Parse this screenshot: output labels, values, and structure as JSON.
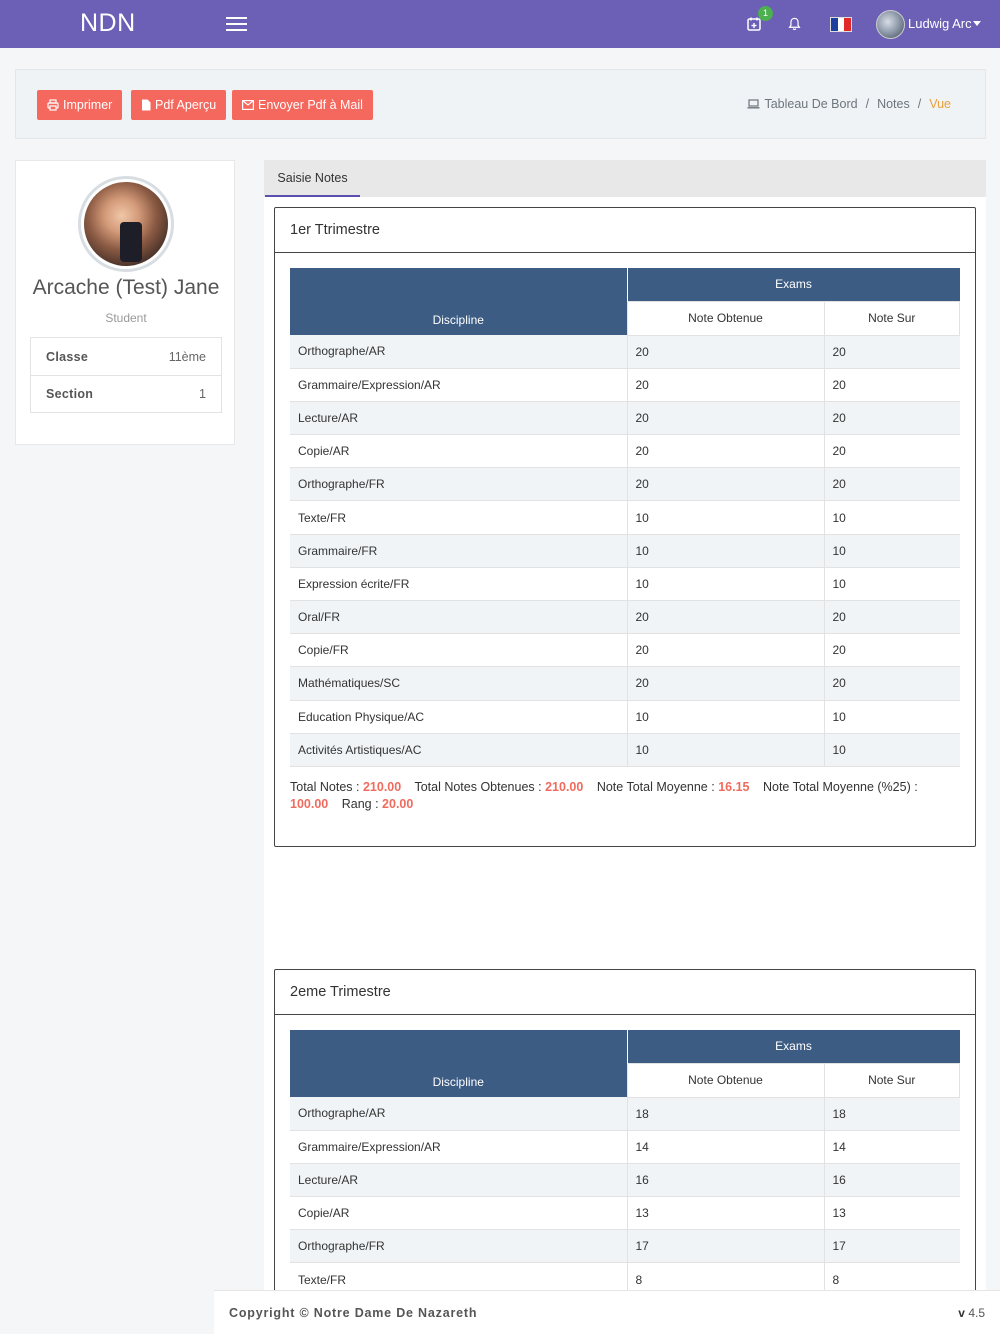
{
  "app": {
    "brand": "NDN"
  },
  "topbar": {
    "calendar_badge": "1",
    "user_name": "Ludwig Arc"
  },
  "toolbar": {
    "print_label": "Imprimer",
    "pdf_preview_label": "Pdf Aperçu",
    "pdf_mail_label": "Envoyer Pdf à Mail"
  },
  "breadcrumb": {
    "home": "Tableau De Bord",
    "sep": "/",
    "notes": "Notes",
    "current": "Vue"
  },
  "profile": {
    "name": "Arcache (Test) Jane",
    "role": "Student",
    "items": [
      {
        "label": "Classe",
        "value": "11ème"
      },
      {
        "label": "Section",
        "value": "1"
      }
    ]
  },
  "tabs": {
    "active": "Saisie Notes"
  },
  "table_headers": {
    "discipline": "Discipline",
    "exams": "Exams",
    "note_obtenue": "Note Obtenue",
    "note_sur": "Note Sur"
  },
  "term1": {
    "title": "1er Ttrimestre",
    "rows": [
      {
        "discipline": "Orthographe/AR",
        "obtenue": "20",
        "sur": "20"
      },
      {
        "discipline": "Grammaire/Expression/AR",
        "obtenue": "20",
        "sur": "20"
      },
      {
        "discipline": "Lecture/AR",
        "obtenue": "20",
        "sur": "20"
      },
      {
        "discipline": "Copie/AR",
        "obtenue": "20",
        "sur": "20"
      },
      {
        "discipline": "Orthographe/FR",
        "obtenue": "20",
        "sur": "20"
      },
      {
        "discipline": "Texte/FR",
        "obtenue": "10",
        "sur": "10"
      },
      {
        "discipline": "Grammaire/FR",
        "obtenue": "10",
        "sur": "10"
      },
      {
        "discipline": "Expression écrite/FR",
        "obtenue": "10",
        "sur": "10"
      },
      {
        "discipline": "Oral/FR",
        "obtenue": "20",
        "sur": "20"
      },
      {
        "discipline": "Copie/FR",
        "obtenue": "20",
        "sur": "20"
      },
      {
        "discipline": "Mathématiques/SC",
        "obtenue": "20",
        "sur": "20"
      },
      {
        "discipline": "Education Physique/AC",
        "obtenue": "10",
        "sur": "10"
      },
      {
        "discipline": "Activités Artistiques/AC",
        "obtenue": "10",
        "sur": "10"
      }
    ],
    "summary": {
      "total_notes_label": "Total Notes :",
      "total_notes": "210.00",
      "total_obtenues_label": "Total Notes Obtenues :",
      "total_obtenues": "210.00",
      "moyenne_label": "Note Total Moyenne :",
      "moyenne": "16.15",
      "moyenne_pct_label": "Note Total Moyenne (%25) :",
      "moyenne_pct": "100.00",
      "rang_label": "Rang :",
      "rang": "20.00"
    }
  },
  "term2": {
    "title": "2eme Trimestre",
    "rows": [
      {
        "discipline": "Orthographe/AR",
        "obtenue": "18",
        "sur": "18"
      },
      {
        "discipline": "Grammaire/Expression/AR",
        "obtenue": "14",
        "sur": "14"
      },
      {
        "discipline": "Lecture/AR",
        "obtenue": "16",
        "sur": "16"
      },
      {
        "discipline": "Copie/AR",
        "obtenue": "13",
        "sur": "13"
      },
      {
        "discipline": "Orthographe/FR",
        "obtenue": "17",
        "sur": "17"
      },
      {
        "discipline": "Texte/FR",
        "obtenue": "8",
        "sur": "8"
      }
    ]
  },
  "footer": {
    "copyright": "Copyright © Notre Dame De Nazareth",
    "version_prefix": "v",
    "version": "4.5"
  },
  "colors": {
    "topbar": "#6b5fb6",
    "button": "#f4685e",
    "table_header": "#3c5c84",
    "accent_value": "#f06b5d",
    "breadcrumb_active": "#e9a03b",
    "badge": "#4caf50"
  },
  "flag_colors": [
    "#1f3fa0",
    "#ffffff",
    "#e02a2a"
  ]
}
